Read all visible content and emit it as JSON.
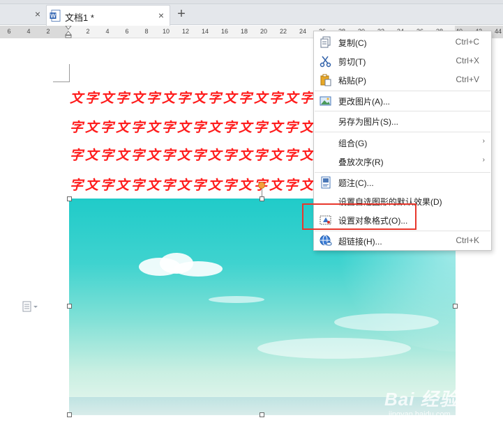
{
  "tabs": {
    "close_glyph": "×",
    "active_title": "文档1 *",
    "new_tab_glyph": "+"
  },
  "ruler": {
    "labels": [
      "6",
      "4",
      "2",
      "2",
      "4",
      "6",
      "8",
      "10",
      "12",
      "14",
      "16",
      "18",
      "20",
      "22",
      "24",
      "26",
      "28",
      "30",
      "32",
      "34",
      "36",
      "38",
      "40",
      "42",
      "44"
    ]
  },
  "document": {
    "rows": [
      "文字文字文字文字文字文字文字文字",
      "字文字文字文字文字文字文字文字文",
      "字文字文字文字文字文字文字文字文",
      "字文字文字文字文字文字文字文字文"
    ],
    "text_color": "#ff1c1c"
  },
  "context_menu": {
    "items": [
      {
        "label": "复制(C)",
        "shortcut": "Ctrl+C",
        "icon": "copy-icon"
      },
      {
        "label": "剪切(T)",
        "shortcut": "Ctrl+X",
        "icon": "scissors-icon"
      },
      {
        "label": "粘贴(P)",
        "shortcut": "Ctrl+V",
        "icon": "paste-icon"
      },
      {
        "label": "更改图片(A)...",
        "shortcut": "",
        "icon": "change-picture-icon"
      },
      {
        "label": "另存为图片(S)...",
        "shortcut": "",
        "icon": ""
      },
      {
        "label": "组合(G)",
        "shortcut": "",
        "icon": "",
        "submenu": true
      },
      {
        "label": "叠放次序(R)",
        "shortcut": "",
        "icon": "",
        "submenu": true
      },
      {
        "label": "题注(C)...",
        "shortcut": "",
        "icon": "caption-icon"
      },
      {
        "label": "设置自选图形的默认效果(D)",
        "shortcut": "",
        "icon": ""
      },
      {
        "label": "设置对象格式(O)...",
        "shortcut": "",
        "icon": "format-object-icon"
      },
      {
        "label": "超链接(H)...",
        "shortcut": "Ctrl+K",
        "icon": "hyperlink-icon"
      }
    ],
    "submenu_arrow": "›",
    "highlight_color": "#e8372c"
  },
  "watermark": {
    "main": "Bai 经验",
    "sub": "jingyan.baidu.com"
  }
}
